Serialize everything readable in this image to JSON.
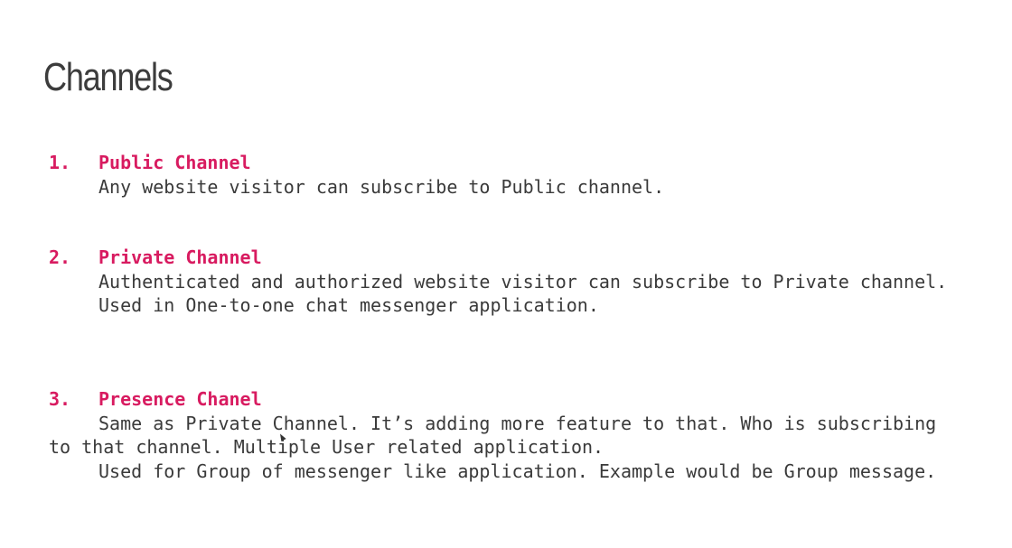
{
  "title": "Channels",
  "items": [
    {
      "number": "1.",
      "heading": "Public Channel",
      "paragraphs": [
        "Any website visitor can subscribe to Public channel."
      ]
    },
    {
      "number": "2.",
      "heading": "Private Channel",
      "paragraphs": [
        "Authenticated and authorized website visitor can subscribe to Private channel.",
        "Used in One-to-one chat messenger application."
      ]
    },
    {
      "number": "3.",
      "heading": "Presence Chanel",
      "paragraphs": [
        "Same as Private Channel. It’s adding more feature to that. Who is subscribing to that channel. Multiple User related application.",
        "Used for Group of messenger like application. Example would be Group message."
      ]
    }
  ],
  "colors": {
    "accent": "#d81b60",
    "body_text": "#3a3a3a",
    "title_text": "#3c3c3c"
  }
}
